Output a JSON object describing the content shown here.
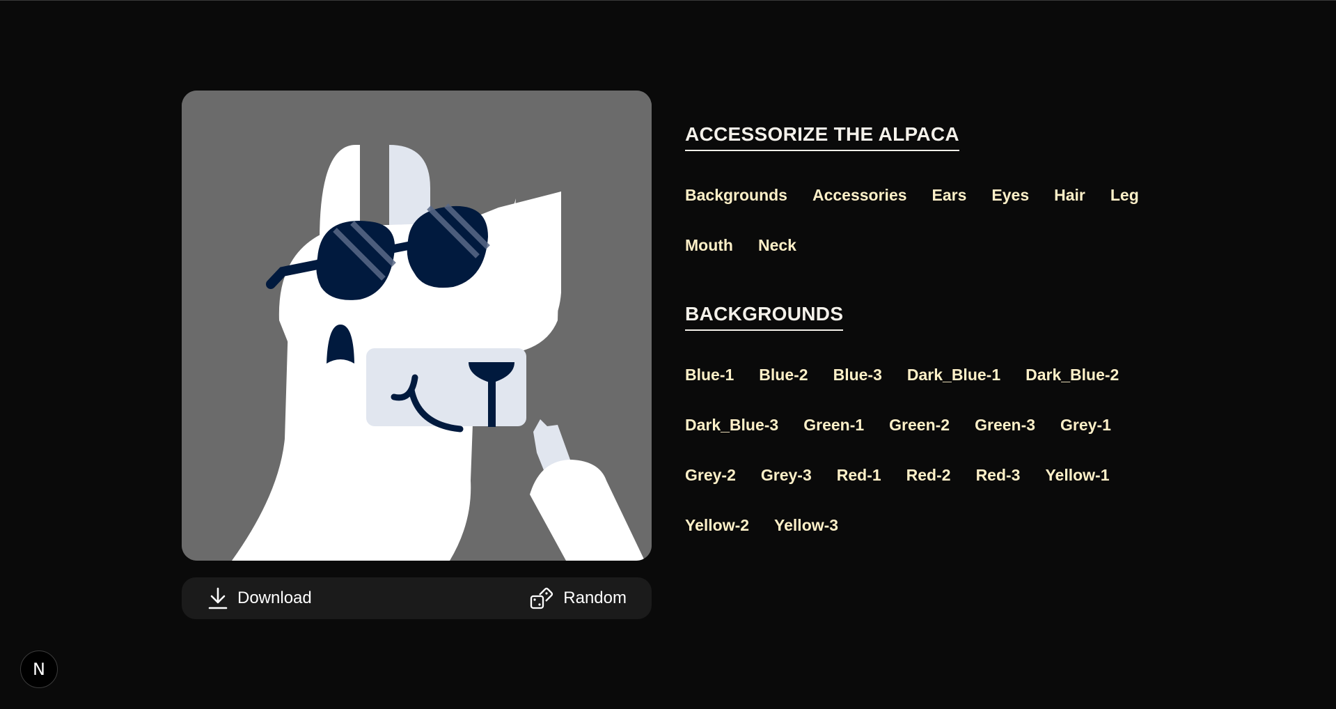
{
  "preview": {
    "background_color": "#6b6b6b",
    "alpaca_color": "#ffffff",
    "accent_color": "#e1e6ef",
    "accessory_color": "#011a3e"
  },
  "actions": {
    "download_label": "Download",
    "download_icon": "download-icon",
    "random_label": "Random",
    "random_icon": "dice-icon"
  },
  "main_title": "ACCESSORIZE THE ALPACA",
  "categories": [
    "Backgrounds",
    "Accessories",
    "Ears",
    "Eyes",
    "Hair",
    "Leg",
    "Mouth",
    "Neck"
  ],
  "section_title": "BACKGROUNDS",
  "options": [
    "Blue-1",
    "Blue-2",
    "Blue-3",
    "Dark_Blue-1",
    "Dark_Blue-2",
    "Dark_Blue-3",
    "Green-1",
    "Green-2",
    "Green-3",
    "Grey-1",
    "Grey-2",
    "Grey-3",
    "Red-1",
    "Red-2",
    "Red-3",
    "Yellow-1",
    "Yellow-2",
    "Yellow-3"
  ],
  "badge": {
    "label": "N",
    "icon": "nextjs-logo-icon"
  }
}
